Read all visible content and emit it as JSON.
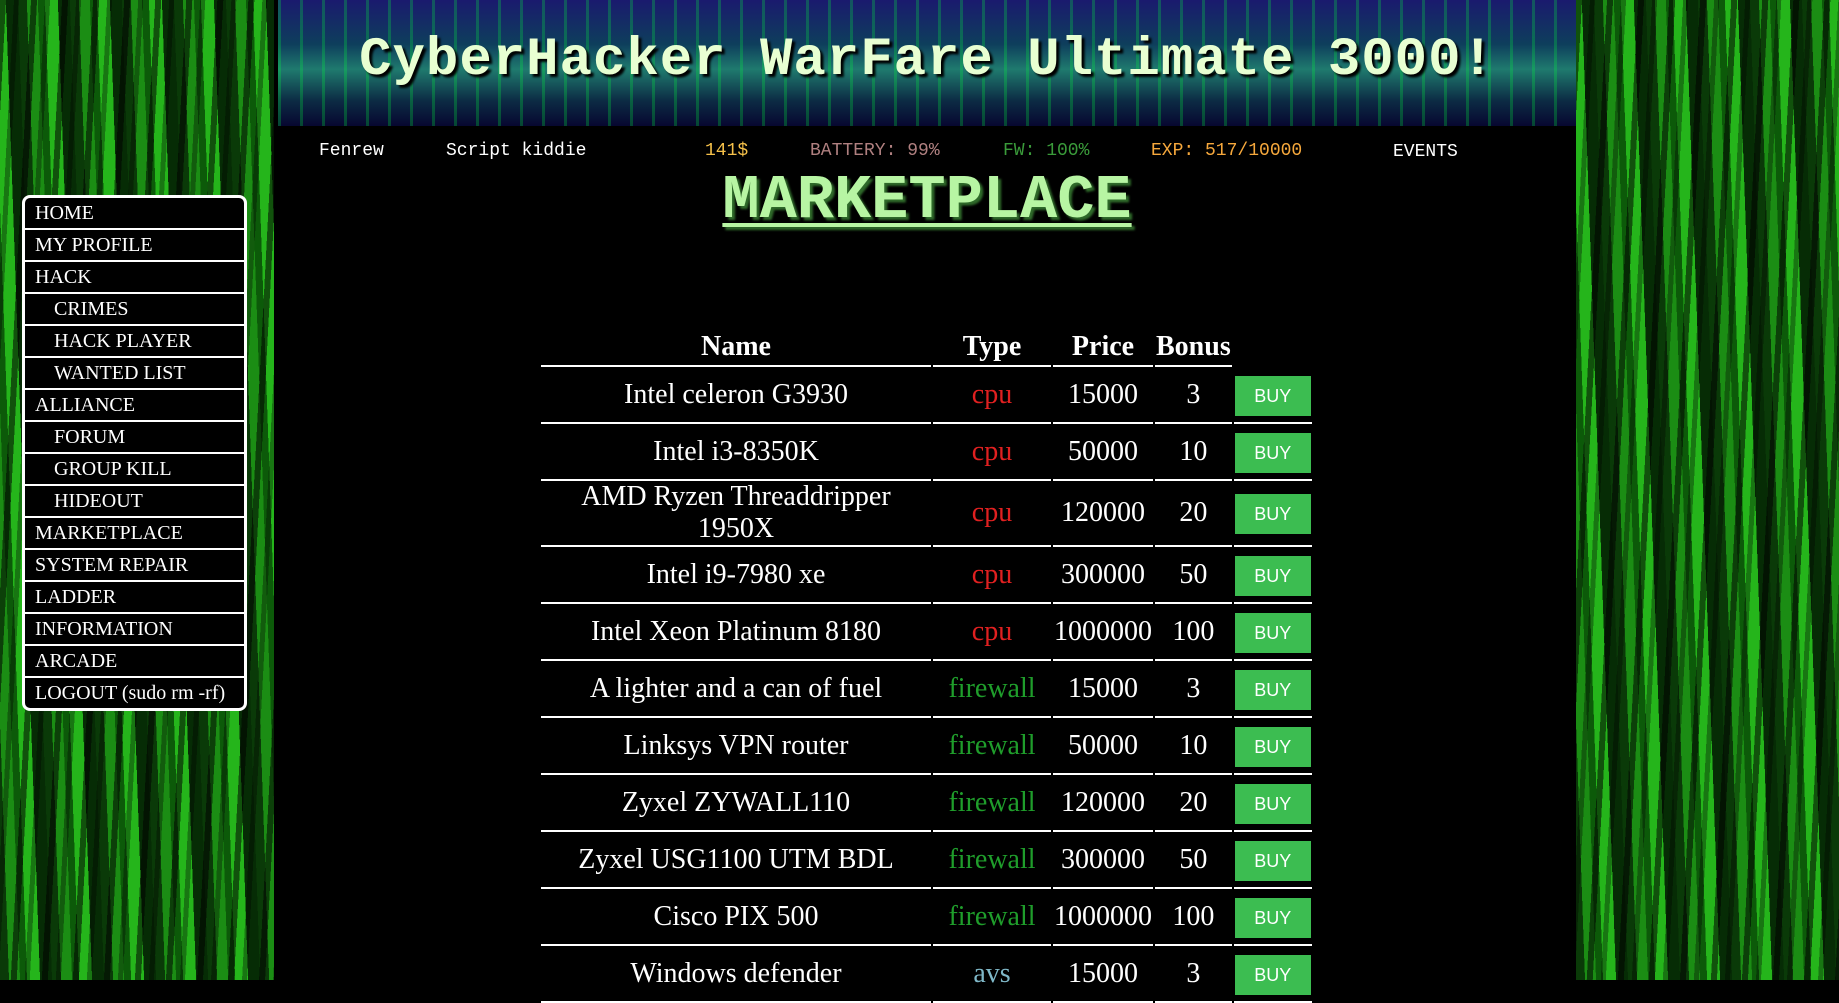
{
  "app": {
    "title": "CyberHacker WarFare Ultimate 3000!"
  },
  "status_bar": {
    "username": "Fenrew",
    "rank": "Script kiddie",
    "money": "141$",
    "battery": "BATTERY: 99%",
    "firewall": "FW: 100%",
    "exp": "EXP: 517/10000",
    "events": "EVENTS"
  },
  "colors": {
    "money": "#f6c14a",
    "battery": "#b08080",
    "firewall": "#3a9b3a",
    "exp": "#f6a83c",
    "cpu": "#e02020",
    "firewall_type": "#1f9d2b",
    "avs": "#7fb8c8",
    "buy_button": "#3cbd51"
  },
  "page_title": "MARKETPLACE",
  "nav": [
    {
      "label": "HOME",
      "sub": false
    },
    {
      "label": "MY PROFILE",
      "sub": false
    },
    {
      "label": "HACK",
      "sub": false
    },
    {
      "label": "CRIMES",
      "sub": true
    },
    {
      "label": "HACK PLAYER",
      "sub": true
    },
    {
      "label": "WANTED LIST",
      "sub": true
    },
    {
      "label": "ALLIANCE",
      "sub": false
    },
    {
      "label": "FORUM",
      "sub": true
    },
    {
      "label": "GROUP KILL",
      "sub": true
    },
    {
      "label": "HIDEOUT",
      "sub": true
    },
    {
      "label": "MARKETPLACE",
      "sub": false
    },
    {
      "label": "SYSTEM REPAIR",
      "sub": false
    },
    {
      "label": "LADDER",
      "sub": false
    },
    {
      "label": "INFORMATION",
      "sub": false
    },
    {
      "label": "ARCADE",
      "sub": false
    },
    {
      "label": "LOGOUT (sudo rm -rf)",
      "sub": false
    }
  ],
  "table": {
    "headers": [
      "Name",
      "Type",
      "Price",
      "Bonus"
    ],
    "buy_label": "BUY",
    "rows": [
      {
        "name": "Intel celeron G3930",
        "type": "cpu",
        "price": "15000",
        "bonus": "3"
      },
      {
        "name": "Intel i3-8350K",
        "type": "cpu",
        "price": "50000",
        "bonus": "10"
      },
      {
        "name": "AMD Ryzen Threaddripper 1950X",
        "type": "cpu",
        "price": "120000",
        "bonus": "20"
      },
      {
        "name": "Intel i9-7980 xe",
        "type": "cpu",
        "price": "300000",
        "bonus": "50"
      },
      {
        "name": "Intel Xeon Platinum 8180",
        "type": "cpu",
        "price": "1000000",
        "bonus": "100"
      },
      {
        "name": "A lighter and a can of fuel",
        "type": "firewall",
        "price": "15000",
        "bonus": "3"
      },
      {
        "name": "Linksys VPN router",
        "type": "firewall",
        "price": "50000",
        "bonus": "10"
      },
      {
        "name": "Zyxel ZYWALL110",
        "type": "firewall",
        "price": "120000",
        "bonus": "20"
      },
      {
        "name": "Zyxel USG1100 UTM BDL",
        "type": "firewall",
        "price": "300000",
        "bonus": "50"
      },
      {
        "name": "Cisco PIX 500",
        "type": "firewall",
        "price": "1000000",
        "bonus": "100"
      },
      {
        "name": "Windows defender",
        "type": "avs",
        "price": "15000",
        "bonus": "3"
      }
    ]
  }
}
